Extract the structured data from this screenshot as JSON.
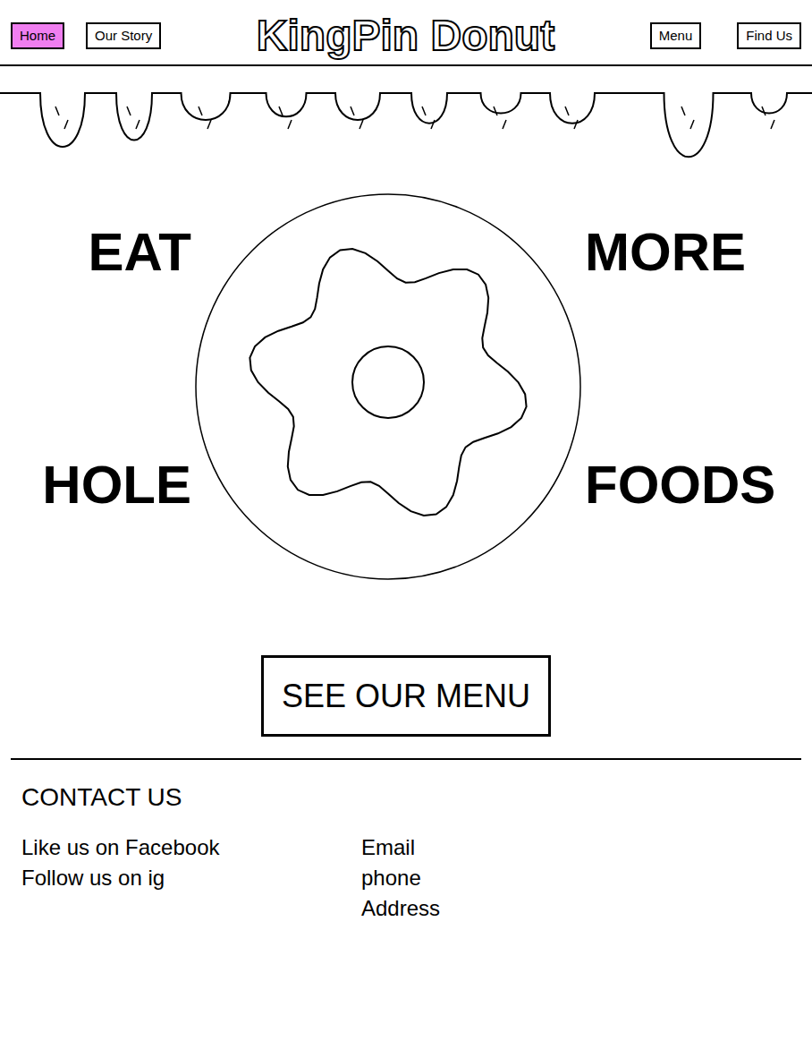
{
  "nav": {
    "left": [
      {
        "label": "Home",
        "selected": true
      },
      {
        "label": "Our Story",
        "selected": false
      }
    ],
    "logo": "KingPin Donut",
    "right": [
      {
        "label": "Menu",
        "selected": false
      },
      {
        "label": "Find Us",
        "selected": false
      }
    ]
  },
  "hero": {
    "top_left": "EAT",
    "top_right": "MORE",
    "bottom_left": "HOLE",
    "bottom_right": "FOODS"
  },
  "cta": "SEE OUR MENU",
  "footer": {
    "title": "CONTACT US",
    "social": [
      "Like us on Facebook",
      "Follow us on ig"
    ],
    "contact": [
      "Email",
      "phone",
      "Address"
    ]
  }
}
